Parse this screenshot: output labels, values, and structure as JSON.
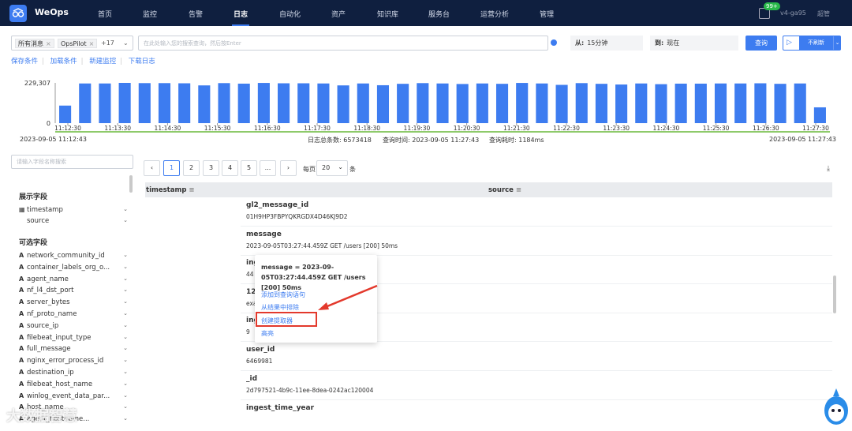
{
  "nav": {
    "brand": "WeOps",
    "items": [
      "首页",
      "监控",
      "告警",
      "日志",
      "自动化",
      "资产",
      "知识库",
      "服务台",
      "运营分析",
      "管理"
    ],
    "active": "日志",
    "notif_count": "99+",
    "user": "v4-ga95",
    "role": "超管"
  },
  "query": {
    "tags": [
      "所有消息",
      "OpsPilot"
    ],
    "tag_more": "+17",
    "search_placeholder": "在此处输入您的搜索查询，然后按Enter",
    "from_label": "从:",
    "from_value": "15分钟",
    "to_label": "到:",
    "to_value": "现在",
    "query_button": "查询",
    "refresh_button": "不刷新",
    "links": [
      "保存条件",
      "加载条件",
      "新建监控",
      "下载日志"
    ]
  },
  "histogram": {
    "chart_data": {
      "type": "bar",
      "ylim": [
        0,
        229307
      ],
      "y_ticks": [
        "229,307",
        "0"
      ],
      "x_ticks": [
        "11:12:30",
        "11:13:30",
        "11:14:30",
        "11:15:30",
        "11:16:30",
        "11:17:30",
        "11:18:30",
        "11:19:30",
        "11:20:30",
        "11:21:30",
        "11:22:30",
        "11:23:30",
        "11:24:30",
        "11:25:30",
        "11:26:30",
        "11:27:30"
      ],
      "values": [
        100000,
        226000,
        226000,
        229307,
        228000,
        228000,
        227000,
        215000,
        228000,
        225000,
        229000,
        227000,
        227000,
        226000,
        215000,
        226000,
        216000,
        224000,
        228000,
        226000,
        223000,
        226000,
        224000,
        229000,
        226000,
        218000,
        228000,
        224000,
        220000,
        226000,
        222000,
        225000,
        225000,
        226000,
        226000,
        227000,
        224000,
        226000,
        90000
      ]
    },
    "start_time": "2023-09-05 11:12:43",
    "end_time": "2023-09-05 11:27:43",
    "total_label": "日志总条数:",
    "total_value": "6573418",
    "query_time_label": "查询时间:",
    "query_time_value": "2023-09-05 11:27:43",
    "elapsed_label": "查询耗时:",
    "elapsed_value": "1184ms"
  },
  "fields_panel": {
    "search_placeholder": "请输入字段名称搜索",
    "display_title": "展示字段",
    "display_fields": [
      {
        "icon": "calendar-icon",
        "name": "timestamp"
      },
      {
        "icon": "",
        "name": "source"
      }
    ],
    "optional_title": "可选字段",
    "optional_fields": [
      "network_community_id",
      "container_labels_org_o...",
      "agent_name",
      "nf_l4_dst_port",
      "server_bytes",
      "nf_proto_name",
      "source_ip",
      "filebeat_input_type",
      "full_message",
      "nginx_error_process_id",
      "destination_ip",
      "filebeat_host_name",
      "winlog_event_data_par...",
      "host_name",
      "agent_hostname..."
    ]
  },
  "results": {
    "pages": [
      "1",
      "2",
      "3",
      "4",
      "5",
      "..."
    ],
    "page_size_label": "每页",
    "page_size": "20",
    "page_size_unit": "条",
    "columns": [
      "timestamp",
      "source"
    ],
    "entries": [
      {
        "key": "gl2_message_id",
        "value": "01H9HP3FBPYQKRGDX4D46KJ9D2"
      },
      {
        "key": "message",
        "value": "2023-09-05T03:27:44.459Z GET /users [200] 50ms"
      },
      {
        "key": "ing",
        "value": "44"
      },
      {
        "key": "12",
        "value": "exa"
      },
      {
        "key": "ing",
        "value": "9"
      },
      {
        "key": "user_id",
        "value": "6469981"
      },
      {
        "key": "_id",
        "value": "2d797521-4b9c-11ee-8dea-0242ac120004"
      },
      {
        "key": "ingest_time_year",
        "value": ""
      }
    ]
  },
  "popup": {
    "title": "message = 2023-09-05T03:27:44.459Z GET /users [200] 50ms",
    "items": [
      "添加到查询语句",
      "从结果中排除",
      "创建提取器",
      "高亮"
    ]
  },
  "watermark": "大数据智慧"
}
